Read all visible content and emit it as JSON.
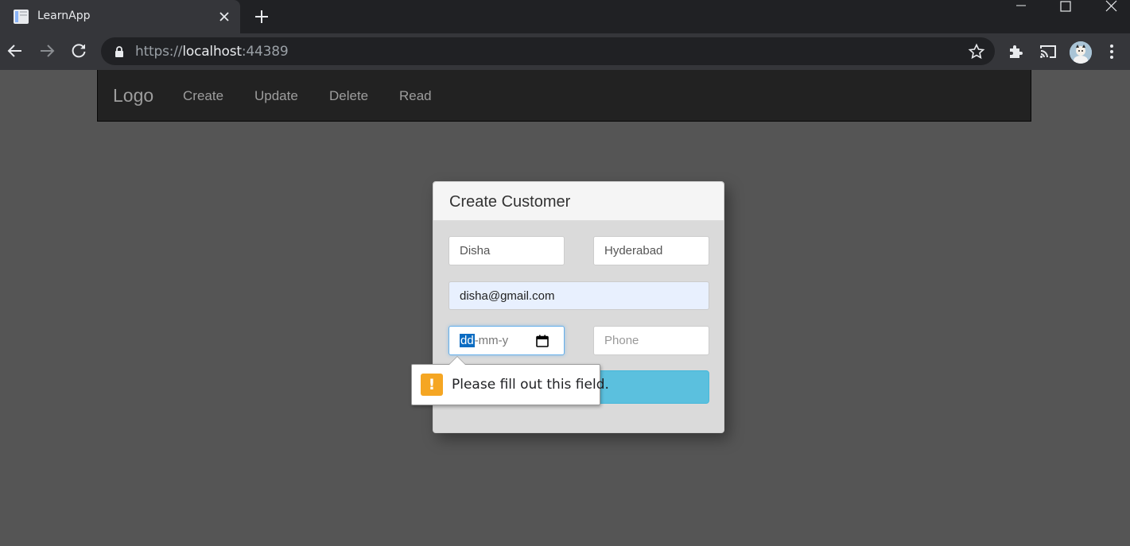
{
  "browser": {
    "tab_title": "LearnApp",
    "url_scheme": "https://",
    "url_host": "localhost",
    "url_port": ":44389"
  },
  "navbar": {
    "brand": "Logo",
    "links": [
      "Create",
      "Update",
      "Delete",
      "Read"
    ]
  },
  "form": {
    "title": "Create Customer",
    "name_value": "Disha",
    "city_value": "Hyderabad",
    "email_value": "disha@gmail.com",
    "dob_selected": "dd",
    "dob_rest": "-mm-y",
    "phone_placeholder": "Phone",
    "submit_label": ""
  },
  "validation": {
    "message": "Please fill out this field.",
    "icon": "!"
  },
  "colors": {
    "submit": "#5bc0de",
    "warning": "#f5a623",
    "navbar": "#222222"
  }
}
